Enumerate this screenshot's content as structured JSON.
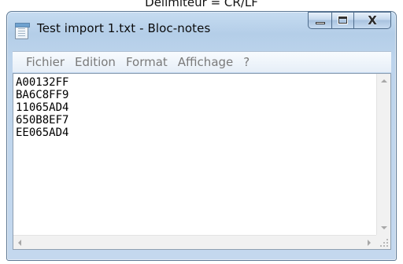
{
  "page_caption": "Délimiteur = CR/LF",
  "window": {
    "title": "Test import 1.txt - Bloc-notes",
    "icon": "notepad-icon",
    "controls": {
      "minimize_icon": "minimize-icon",
      "maximize_icon": "maximize-icon",
      "close_glyph": "X"
    }
  },
  "menubar": {
    "items": [
      {
        "label": "Fichier"
      },
      {
        "label": "Edition"
      },
      {
        "label": "Format"
      },
      {
        "label": "Affichage"
      },
      {
        "label": "?"
      }
    ]
  },
  "editor": {
    "lines": [
      "A00132FF",
      "BA6C8FF9",
      "11065AD4",
      "650B8EF7",
      "EE065AD4"
    ]
  },
  "colors": {
    "frame": "#c4d8ee",
    "menu_text": "#7a7a7a",
    "editor_bg": "#ffffff"
  }
}
